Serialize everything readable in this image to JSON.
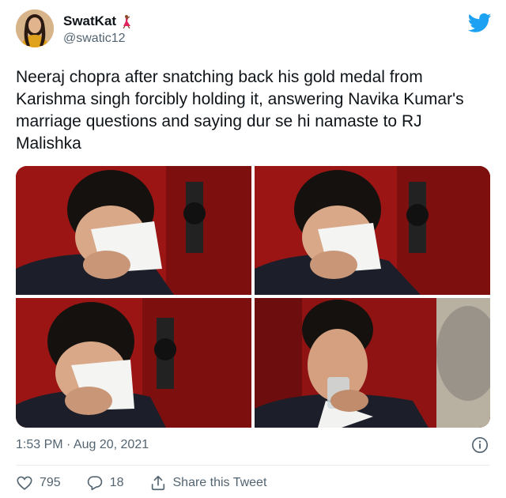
{
  "author": {
    "display_name": "SwatKat",
    "handle": "@swatic12",
    "badge_icon": "dancer-emoji-icon"
  },
  "tweet": {
    "text": "Neeraj chopra after snatching back his gold medal from Karishma singh forcibly holding it, answering Navika Kumar's marriage questions and saying dur se hi namaste to RJ Malishka",
    "timestamp": "1:53 PM · Aug 20, 2021"
  },
  "metrics": {
    "likes": "795",
    "replies": "18",
    "share_label": "Share this Tweet"
  },
  "icons": {
    "brand": "twitter-bird-icon",
    "info": "info-icon",
    "like": "heart-icon",
    "reply": "reply-bubble-icon",
    "share": "share-icon"
  },
  "colors": {
    "brand_blue": "#1da1f2",
    "text_primary": "#0f1419",
    "text_secondary": "#536471",
    "divider": "#e6ecf0"
  }
}
